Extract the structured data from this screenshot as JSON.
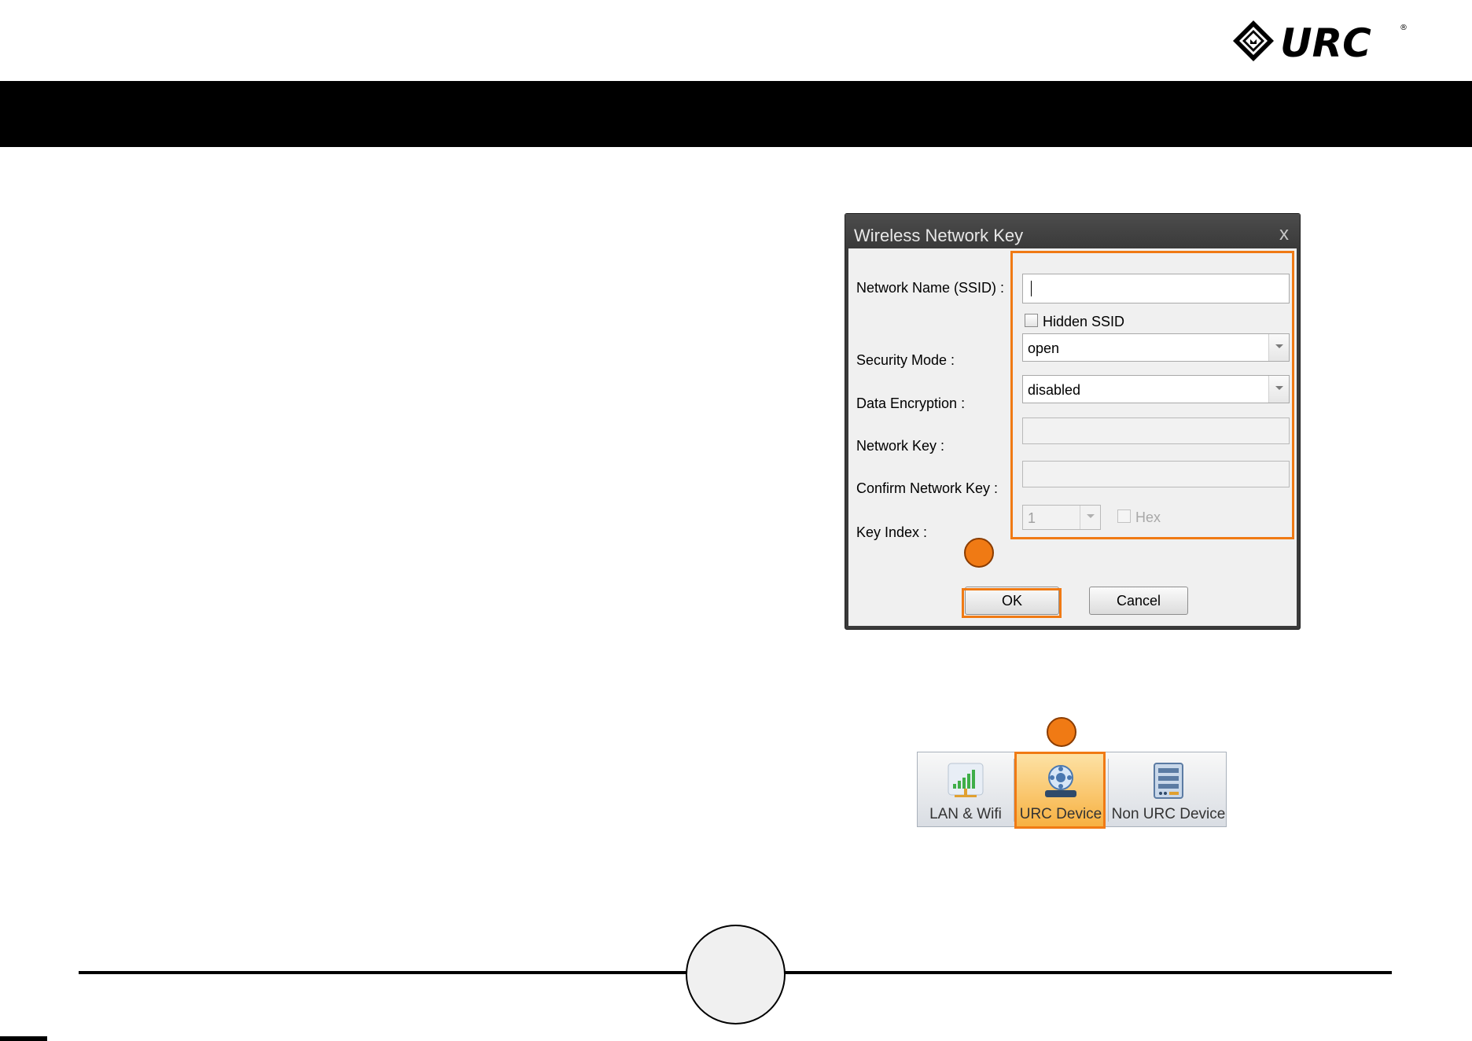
{
  "logo": {
    "text": "URC",
    "registered": "®"
  },
  "dialog": {
    "title": "Wireless Network Key",
    "close_glyph": "x",
    "labels": {
      "ssid": "Network Name (SSID) :",
      "hidden_ssid": "Hidden SSID",
      "security_mode": "Security Mode :",
      "data_encryption": "Data Encryption :",
      "network_key": "Network Key :",
      "confirm_key": "Confirm Network Key :",
      "key_index": "Key Index :",
      "hex": "Hex"
    },
    "values": {
      "ssid": "",
      "security_mode": "open",
      "data_encryption": "disabled",
      "network_key": "",
      "confirm_key": "",
      "key_index": "1"
    },
    "ok_label": "OK",
    "cancel_label": "Cancel"
  },
  "toolbar": {
    "items": [
      {
        "label": "LAN & Wifi",
        "icon": "signal-bars-icon",
        "selected": false
      },
      {
        "label": "URC Device",
        "icon": "urc-device-icon",
        "selected": true
      },
      {
        "label": "Non URC Device",
        "icon": "server-rack-icon",
        "selected": false
      }
    ]
  },
  "colors": {
    "accent": "#f07a14",
    "header_bar": "#000000",
    "dialog_frame": "#3a3a3a"
  }
}
